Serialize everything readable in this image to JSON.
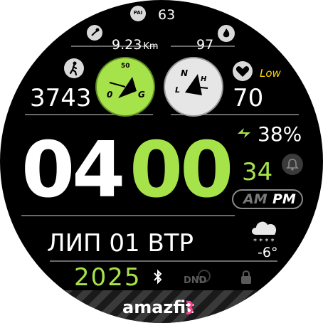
{
  "pai": {
    "icon": "pai-icon",
    "badge": "PAI",
    "value": "63"
  },
  "distance": {
    "icon": "route-icon",
    "value": "9.23",
    "unit": "Km"
  },
  "calories": {
    "icon": "flame-icon",
    "value": "97"
  },
  "steps": {
    "icon": "walking-icon",
    "value": "3743"
  },
  "heart": {
    "icon": "heart-icon",
    "value": "70",
    "status": "Low"
  },
  "gauges": {
    "steps_gauge": {
      "label_top": "50",
      "label_left": "0",
      "label_right": "G"
    },
    "compass": {
      "label_n": "N",
      "label_h": "H",
      "label_l": "L"
    }
  },
  "time": {
    "hours": "04",
    "minutes": "00",
    "am": "AM",
    "pm": "PM"
  },
  "battery": {
    "icon": "bolt-icon",
    "value": "38%"
  },
  "temp_secondary": {
    "value": "34"
  },
  "alarm": {
    "icon": "alarm-bell-icon"
  },
  "date": {
    "text": "ЛИП 01 ВТР"
  },
  "weather": {
    "icon": "snow-cloud-icon",
    "value": "-6°"
  },
  "year": {
    "value": "2025"
  },
  "bluetooth": {
    "icon": "bluetooth-icon"
  },
  "dnd": {
    "label": "DND"
  },
  "lock": {
    "icon": "lock-icon"
  },
  "brand": {
    "logo_text": "amazfit"
  },
  "colors": {
    "accent": "#a6e34b",
    "warning": "#ffd400",
    "text": "#ffffff",
    "muted": "#707070"
  }
}
